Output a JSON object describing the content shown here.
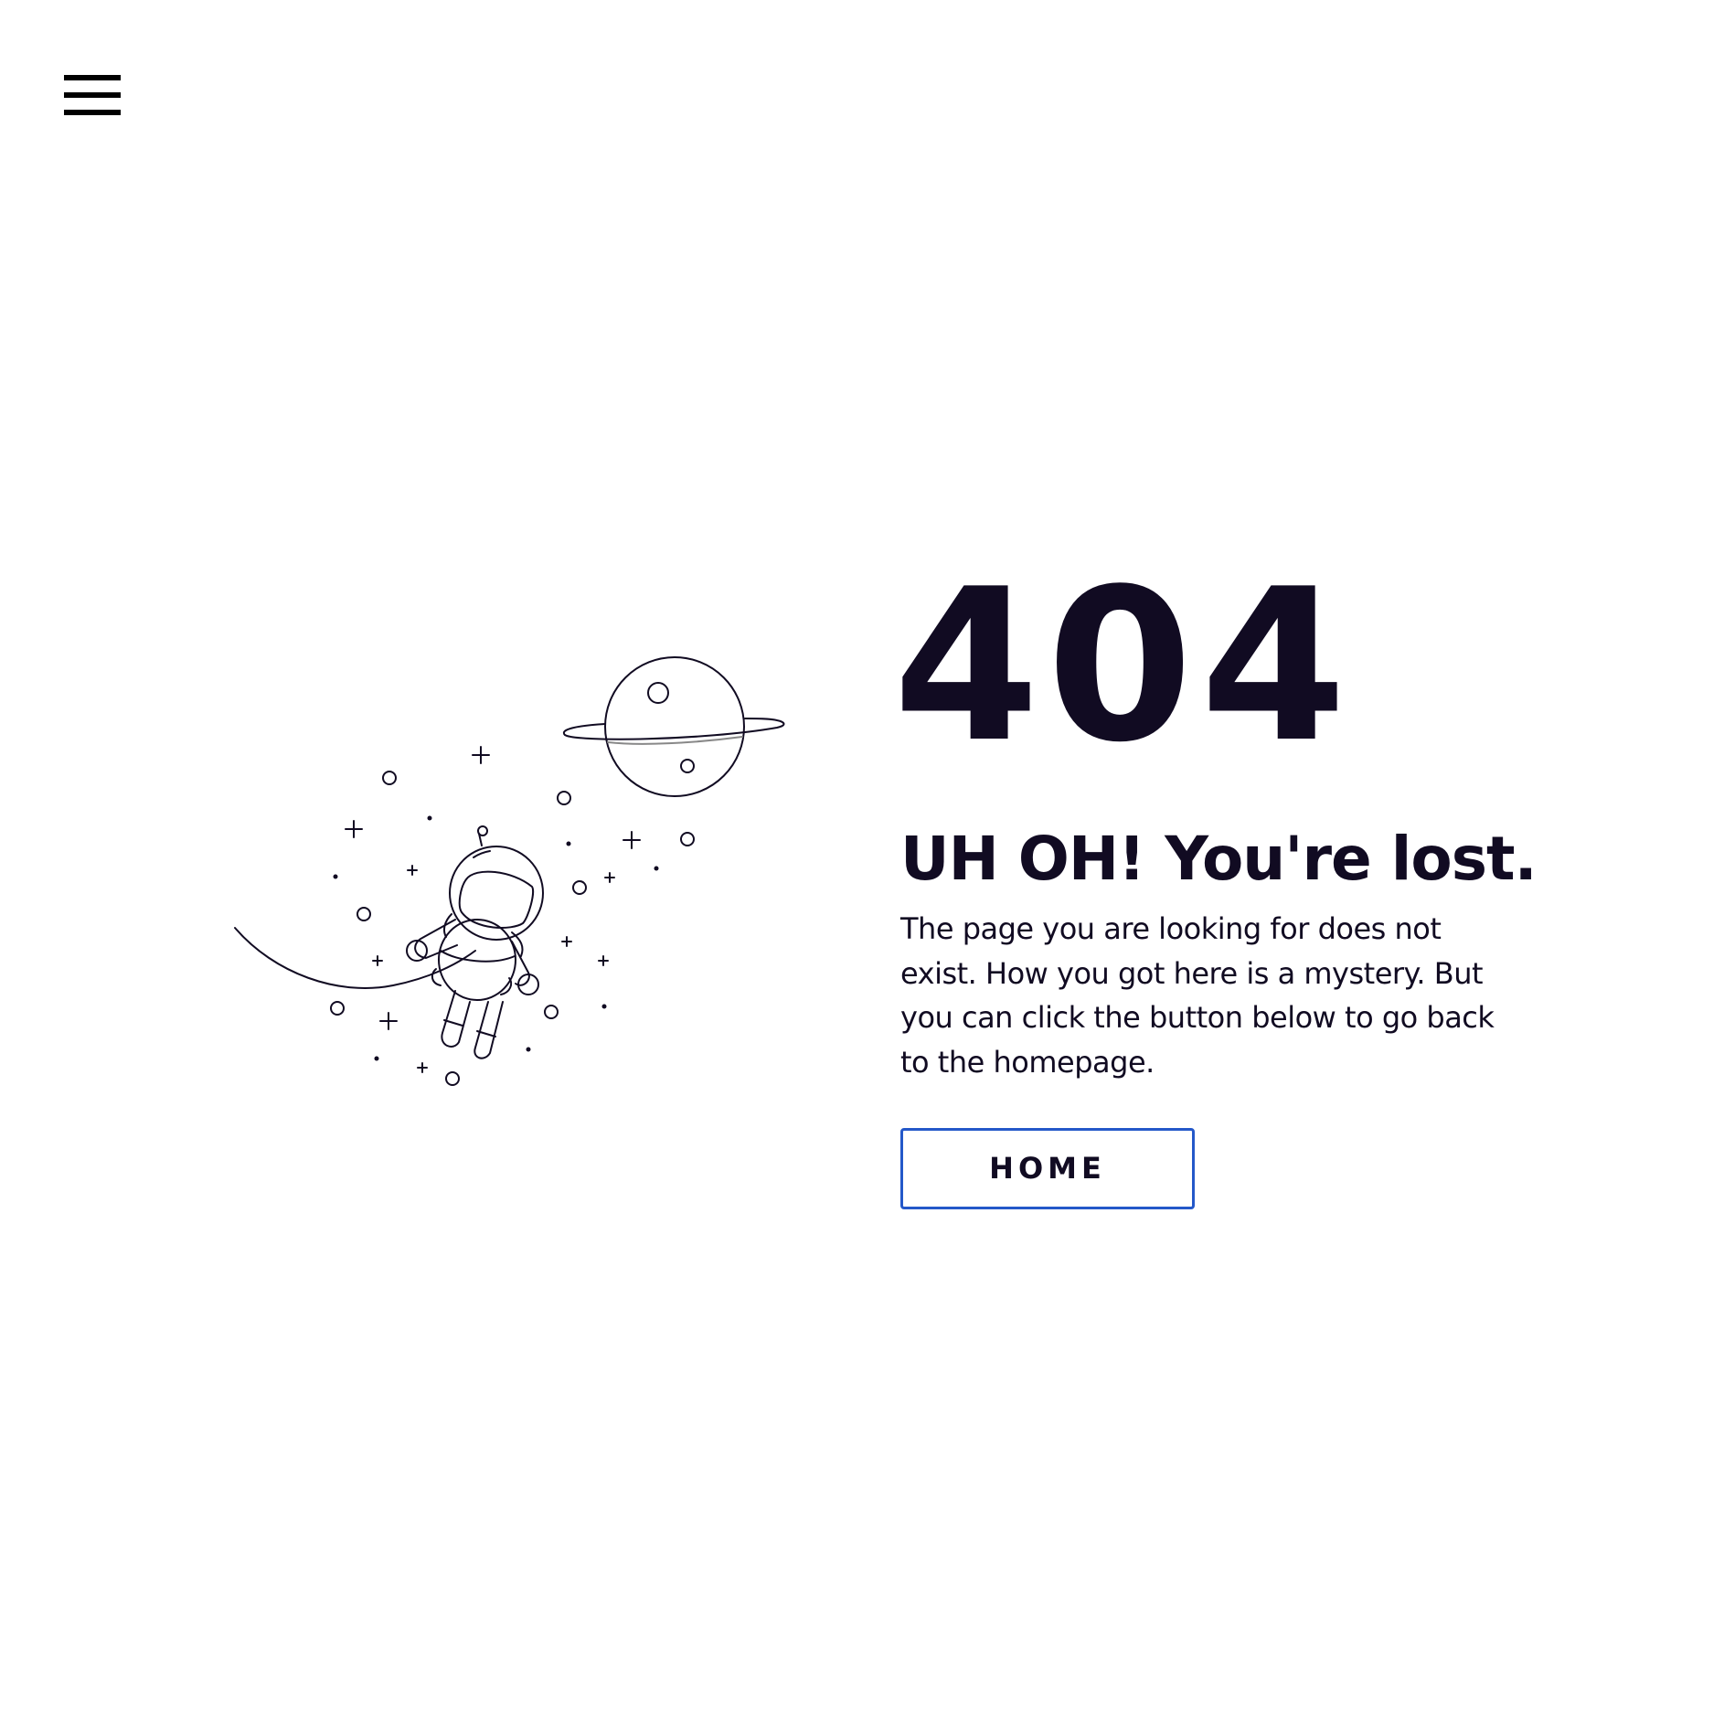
{
  "nav": {
    "menu_icon": "hamburger-menu-icon"
  },
  "illustration": {
    "subject_icon": "astronaut-icon",
    "planet_icon": "planet-icon"
  },
  "error": {
    "code": "404",
    "headline": "UH OH! You're lost.",
    "description": "The page you are looking for does not exist. How you got here is a mystery. But you can click the button below to go back to the homepage.",
    "button_label": "HOME"
  },
  "colors": {
    "text": "#110b22",
    "button_border": "#2458c9",
    "background": "#ffffff"
  }
}
